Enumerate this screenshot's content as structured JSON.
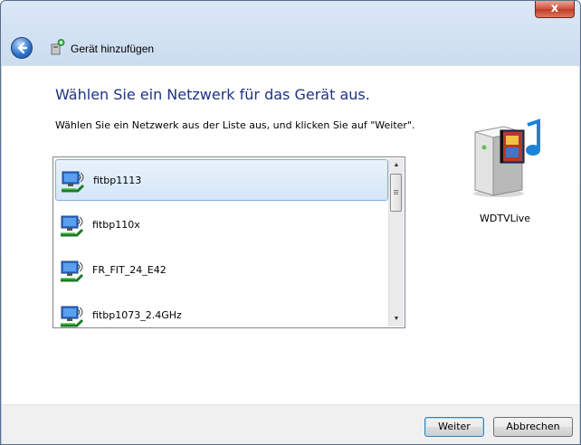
{
  "window": {
    "close_label": "x"
  },
  "header": {
    "title": "Gerät hinzufügen"
  },
  "main": {
    "heading": "Wählen Sie ein Netzwerk für das Gerät aus.",
    "instruction": "Wählen Sie ein Netzwerk aus der Liste aus, und klicken Sie auf \"Weiter\"."
  },
  "networks": [
    {
      "name": "fitbp1113",
      "selected": true
    },
    {
      "name": "fitbp110x",
      "selected": false
    },
    {
      "name": "FR_FIT_24_E42",
      "selected": false
    },
    {
      "name": "fitbp1073_2.4GHz",
      "selected": false
    }
  ],
  "device": {
    "name": "WDTVLive",
    "icon": "media-player-device-icon"
  },
  "buttons": {
    "next": "Weiter",
    "cancel": "Abbrechen"
  },
  "colors": {
    "heading": "#1e3287",
    "selection": "#d5e6f8"
  }
}
